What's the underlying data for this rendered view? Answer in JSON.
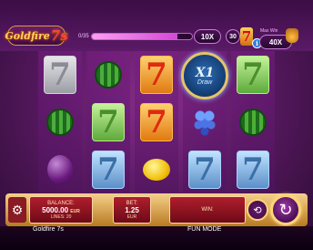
{
  "header": {
    "logo_text": "Goldfire",
    "logo_seven": "7s",
    "progress_label": "0/35",
    "progress_fraction": 0.85,
    "multiplier": "10X",
    "win_count": "30",
    "max_label": "Max Win",
    "max_value": "40X",
    "info_symbol": "i",
    "chip_symbol": "7"
  },
  "reels": [
    [
      "seven-silver",
      "watermelon",
      "plum"
    ],
    [
      "watermelon",
      "seven-green",
      "seven-blue"
    ],
    [
      "seven-red",
      "seven-red",
      "lemon"
    ],
    [
      "bonus-medallion",
      "grapes",
      "seven-blue"
    ],
    [
      "seven-green",
      "watermelon",
      "seven-blue"
    ]
  ],
  "reel_symbol_text": "7",
  "bonus": {
    "value": "X1",
    "label": "Draw"
  },
  "controls": {
    "balance_label": "BALANCE:",
    "balance_value": "5000.00",
    "balance_currency": "EUR",
    "lines_label": "LINES: 20",
    "bet_label": "BET:",
    "bet_value": "1.25",
    "bet_currency": "EUR",
    "win_label": "WIN:",
    "settings_icon": "⚙",
    "autoplay_icon": "⟲",
    "spin_icon": "↻"
  },
  "footer": {
    "title": "Goldfire 7s",
    "mode": "FUN MODE"
  }
}
